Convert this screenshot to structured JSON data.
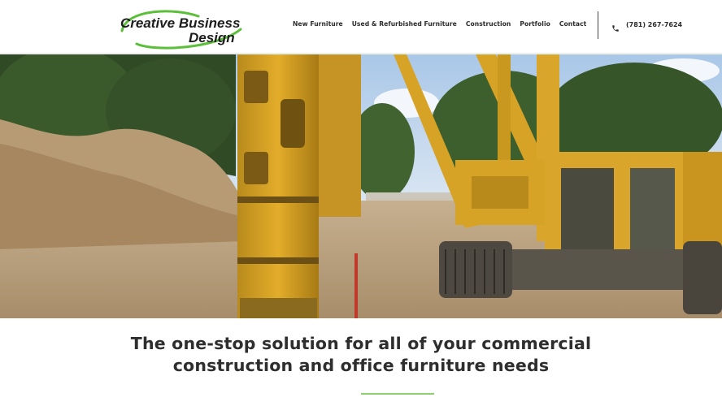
{
  "brand": {
    "logo_line1": "Creative Business",
    "logo_line2": "Design",
    "accent_color": "#5cbf3a"
  },
  "nav": {
    "items": [
      {
        "label": "New Furniture"
      },
      {
        "label": "Used & Refurbished Furniture"
      },
      {
        "label": "Construction"
      },
      {
        "label": "Portfolio"
      },
      {
        "label": "Contact"
      }
    ]
  },
  "contact": {
    "phone": "(781) 267-7624",
    "icon": "phone-icon"
  },
  "hero": {
    "image": "construction-site-pile-driver"
  },
  "headline": {
    "line1": "The one-stop solution for all of your commercial",
    "line2": "construction and office furniture needs"
  },
  "colors": {
    "accent_line": "#8bcf70",
    "text": "#2e2e2e"
  }
}
